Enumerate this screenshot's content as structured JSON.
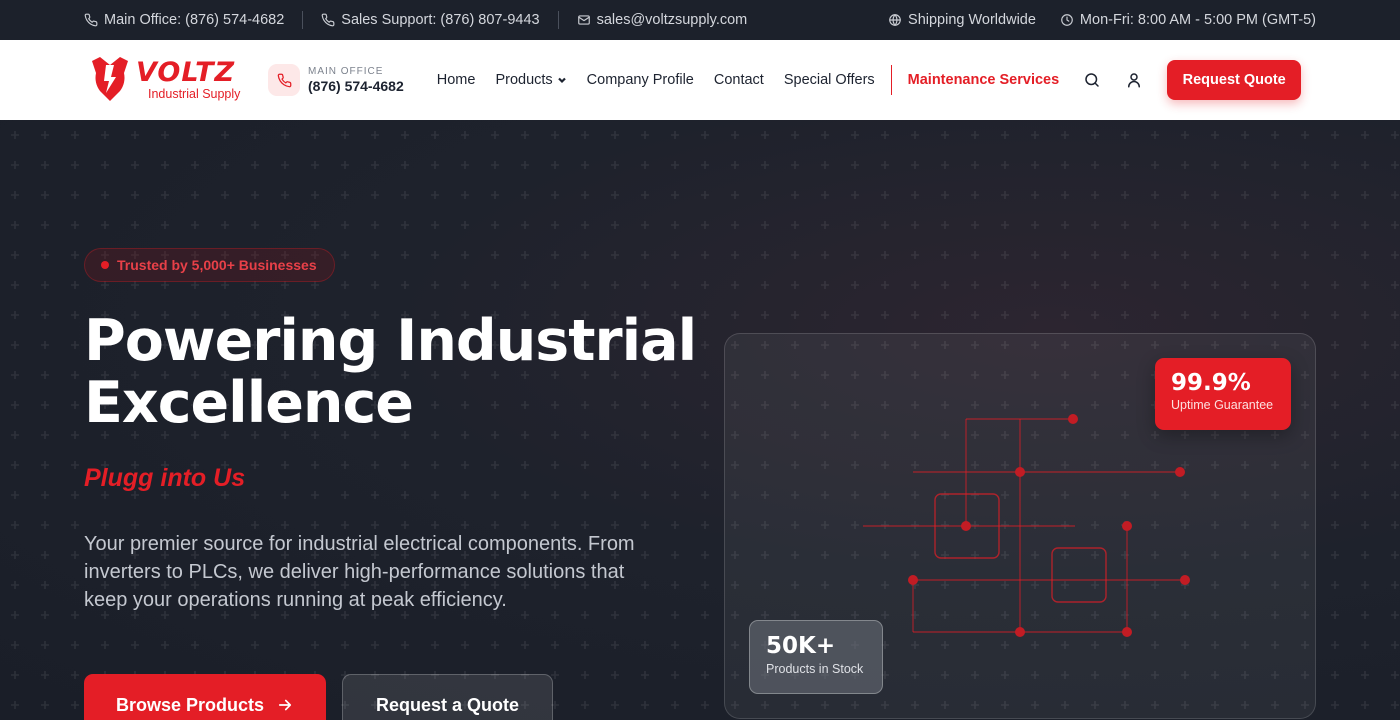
{
  "topbar": {
    "main_office": "Main Office: (876) 574-4682",
    "sales_support": "Sales Support: (876) 807-9443",
    "email": "sales@voltzsupply.com",
    "shipping": "Shipping Worldwide",
    "hours": "Mon-Fri: 8:00 AM - 5:00 PM (GMT-5)",
    "icons": [
      "phone-icon",
      "phone-icon",
      "mail-icon",
      "globe-icon",
      "clock-icon"
    ]
  },
  "brand": {
    "name": "VOLTZ",
    "subtitle": "Industrial Supply",
    "color": "#e41e26"
  },
  "nav": {
    "phone_label": "MAIN OFFICE",
    "phone_number": "(876) 574-4682",
    "items": [
      {
        "label": "Home"
      },
      {
        "label": "Products"
      },
      {
        "label": "Company Profile"
      },
      {
        "label": "Contact"
      },
      {
        "label": "Special Offers"
      },
      {
        "label": "Maintenance Services"
      }
    ],
    "quote_button": "Request Quote"
  },
  "hero": {
    "badge": "Trusted by 5,000+ Businesses",
    "headline_line1": "Powering Industrial",
    "headline_line2": "Excellence",
    "tagline": "Plugg into Us",
    "description": "Your premier source for industrial electrical components. From inverters to PLCs, we deliver high-performance solutions that keep your operations running at peak efficiency.",
    "primary_button": "Browse Products",
    "secondary_button": "Request a Quote",
    "stats": [
      {
        "value": "99.9%",
        "label": "Uptime Guarantee"
      },
      {
        "value": "50K+",
        "label": "Products in Stock"
      }
    ]
  },
  "colors": {
    "accent": "#e41e26",
    "dark_bg": "#1a1e28",
    "topbar_bg": "#1c212b"
  }
}
